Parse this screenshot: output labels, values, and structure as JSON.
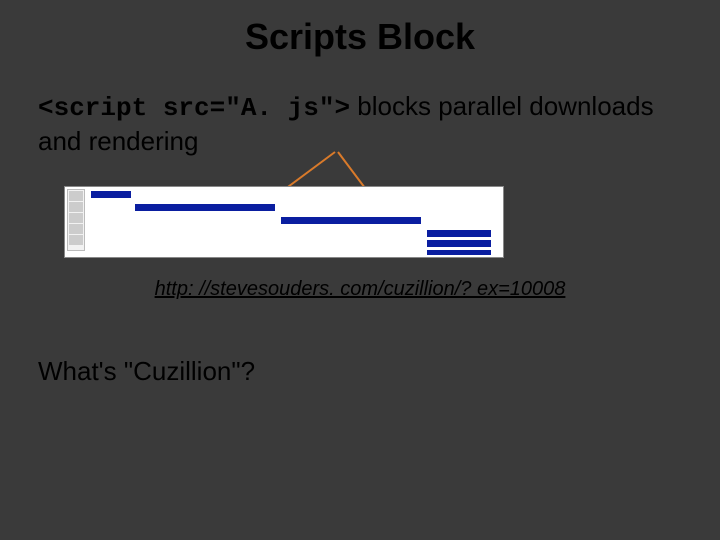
{
  "title": "Scripts Block",
  "code_inline": "<script src=\"A. js\">",
  "desc_text": " blocks parallel downloads and rendering",
  "link": "http: //stevesouders. com/cuzillion/? ex=10008",
  "question": "What's \"Cuzillion\"?"
}
